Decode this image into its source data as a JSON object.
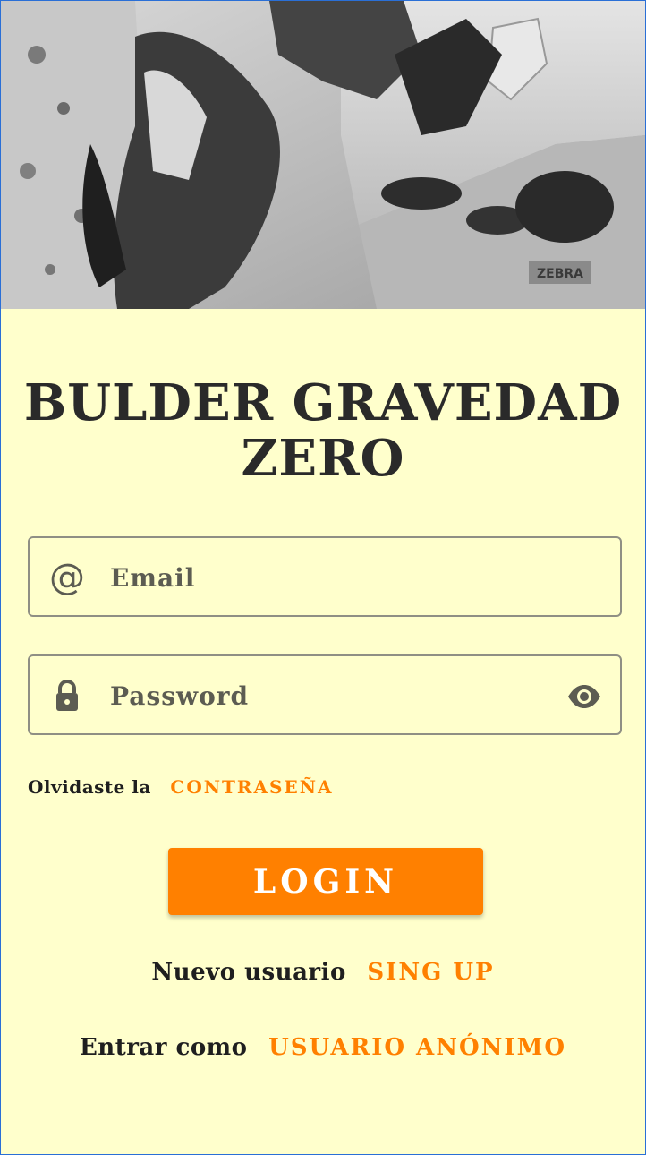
{
  "app": {
    "title": "BULDER GRAVEDAD ZERO"
  },
  "hero": {
    "image_name": "climber-bouldering-photo"
  },
  "form": {
    "email": {
      "placeholder": "Email",
      "value": "",
      "icon": "at-icon",
      "icon_glyph": "@"
    },
    "password": {
      "placeholder": "Password",
      "value": "",
      "icon": "lock-icon",
      "toggle_icon": "eye-icon"
    }
  },
  "forgot": {
    "text": "Olvidaste la",
    "link": "CONTRASEÑA"
  },
  "login": {
    "label": "LOGIN"
  },
  "signup": {
    "text": "Nuevo usuario",
    "link": "SING UP"
  },
  "anonymous": {
    "text": "Entrar como",
    "link": "USUARIO ANÓNIMO"
  },
  "colors": {
    "background": "#ffffcc",
    "accent": "#ff8000",
    "text": "#1f1f1f",
    "field_border": "#8f8f84"
  }
}
